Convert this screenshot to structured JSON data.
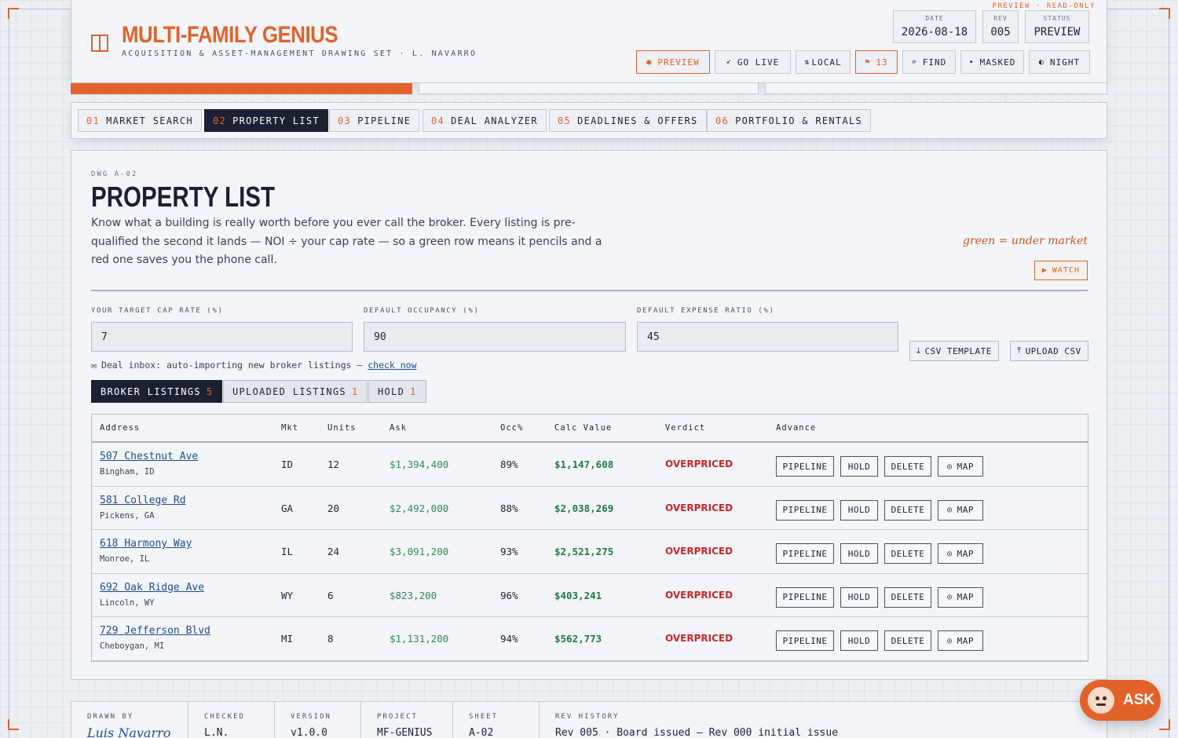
{
  "header": {
    "preview_note": "PREVIEW · READ-ONLY",
    "brand": "MULTI-FAMILY GENIUS",
    "subtitle": "ACQUISITION & ASSET-MANAGEMENT DRAWING SET · L. NAVARRO",
    "date_label": "DATE",
    "date": "2026-08-18",
    "rev_label": "REV",
    "rev": "005",
    "status_label": "STATUS",
    "status": "PREVIEW",
    "buttons": {
      "preview": "PREVIEW",
      "go_live": "GO LIVE",
      "local": "LOCAL",
      "flags": "13",
      "find": "FIND",
      "masked": "MASKED",
      "night": "NIGHT"
    }
  },
  "tabs": [
    {
      "num": "01",
      "label": "MARKET SEARCH"
    },
    {
      "num": "02",
      "label": "PROPERTY LIST"
    },
    {
      "num": "03",
      "label": "PIPELINE"
    },
    {
      "num": "04",
      "label": "DEAL ANALYZER"
    },
    {
      "num": "05",
      "label": "DEADLINES & OFFERS"
    },
    {
      "num": "06",
      "label": "PORTFOLIO & RENTALS"
    }
  ],
  "page": {
    "dwg": "DWG A-02",
    "title": "PROPERTY LIST",
    "intro": "Know what a building is really worth before you ever call the broker. Every listing is pre-qualified the second it lands — NOI ÷ your cap rate — so a green row means it pencils and a red one saves you the phone call.",
    "hint": "green = under market",
    "watch": "WATCH"
  },
  "inputs": {
    "cap_rate_label": "YOUR TARGET CAP RATE (%)",
    "cap_rate": "7",
    "occupancy_label": "DEFAULT OCCUPANCY (%)",
    "occupancy": "90",
    "expense_label": "DEFAULT EXPENSE RATIO (%)",
    "expense": "45",
    "csv_template": "CSV TEMPLATE",
    "upload_csv": "UPLOAD CSV"
  },
  "inbox": {
    "text": "Deal inbox: auto-importing new broker listings —",
    "link": "check now"
  },
  "subtabs": [
    {
      "label": "BROKER LISTINGS",
      "count": "5"
    },
    {
      "label": "UPLOADED LISTINGS",
      "count": "1"
    },
    {
      "label": "HOLD",
      "count": "1"
    }
  ],
  "table": {
    "columns": [
      "Address",
      "Mkt",
      "Units",
      "Ask",
      "Occ%",
      "Calc Value",
      "Verdict",
      "Advance"
    ],
    "actions": [
      "PIPELINE",
      "HOLD",
      "DELETE",
      "MAP"
    ],
    "rows": [
      {
        "address": "507 Chestnut Ave",
        "city": "Bingham, ID",
        "mkt": "ID",
        "units": "12",
        "ask": "$1,394,400",
        "occ": "89%",
        "calc": "$1,147,608",
        "verdict": "OVERPRICED"
      },
      {
        "address": "581 College Rd",
        "city": "Pickens, GA",
        "mkt": "GA",
        "units": "20",
        "ask": "$2,492,000",
        "occ": "88%",
        "calc": "$2,038,269",
        "verdict": "OVERPRICED"
      },
      {
        "address": "618 Harmony Way",
        "city": "Monroe, IL",
        "mkt": "IL",
        "units": "24",
        "ask": "$3,091,200",
        "occ": "93%",
        "calc": "$2,521,275",
        "verdict": "OVERPRICED"
      },
      {
        "address": "692 Oak Ridge Ave",
        "city": "Lincoln, WY",
        "mkt": "WY",
        "units": "6",
        "ask": "$823,200",
        "occ": "96%",
        "calc": "$403,241",
        "verdict": "OVERPRICED"
      },
      {
        "address": "729 Jefferson Blvd",
        "city": "Cheboygan, MI",
        "mkt": "MI",
        "units": "8",
        "ask": "$1,131,200",
        "occ": "94%",
        "calc": "$562,773",
        "verdict": "OVERPRICED"
      }
    ]
  },
  "footer": {
    "drawn_by_label": "DRAWN BY",
    "drawn_by": "Luis Navarro",
    "checked_label": "CHECKED",
    "checked": "L.N.",
    "version_label": "VERSION",
    "version": "v1.0.0",
    "project_label": "PROJECT",
    "project": "MF-GENIUS",
    "sheet_label": "SHEET",
    "sheet": "A-02",
    "rev_history_label": "REV HISTORY",
    "rev_history": "Rev 005 · Board issued — Rev 000 initial issue"
  },
  "ask_button": "ASK",
  "colors": {
    "accent": "#e2622b",
    "ink": "#1b2033",
    "green": "#2f8a53",
    "red": "#c8262a"
  }
}
